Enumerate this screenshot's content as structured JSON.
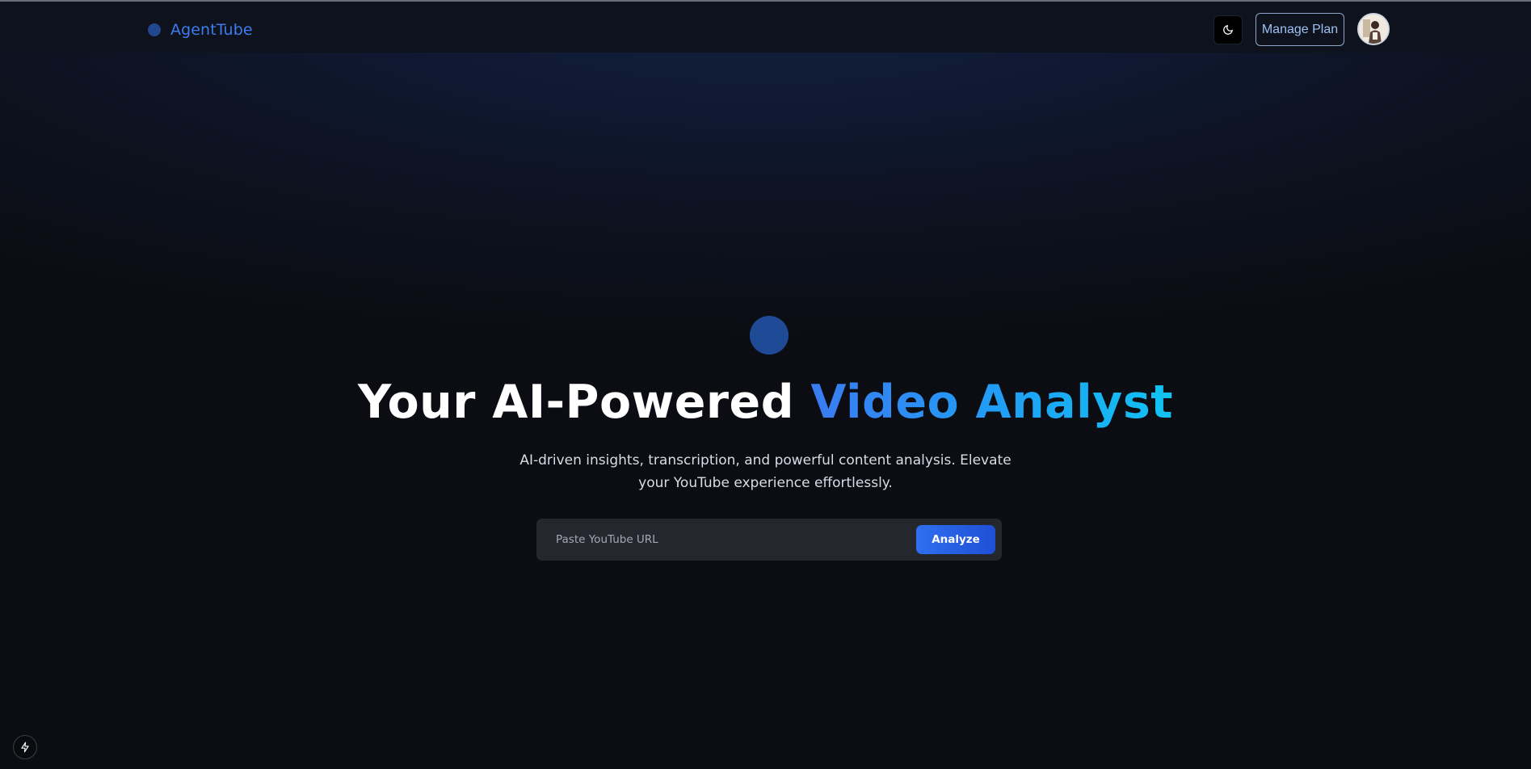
{
  "header": {
    "brand_name": "AgentTube",
    "manage_plan_label": "Manage Plan",
    "theme_toggle_icon": "moon-icon",
    "avatar_icon": "user-avatar-icon"
  },
  "hero": {
    "headline_white": "Your AI-Powered",
    "headline_gradient": "Video Analyst",
    "subtitle": "AI-driven insights, transcription, and powerful content analysis. Elevate your YouTube experience effortlessly."
  },
  "search": {
    "placeholder": "Paste YouTube URL",
    "value": "",
    "button_label": "Analyze"
  },
  "footer": {
    "dev_tools_icon": "lightning-bolt-icon"
  },
  "colors": {
    "accent": "#3b7cf0",
    "button": "#2f6ff0",
    "gradient_start": "#3a7bf2",
    "gradient_end": "#11c3f2",
    "background": "#0b0d13"
  }
}
